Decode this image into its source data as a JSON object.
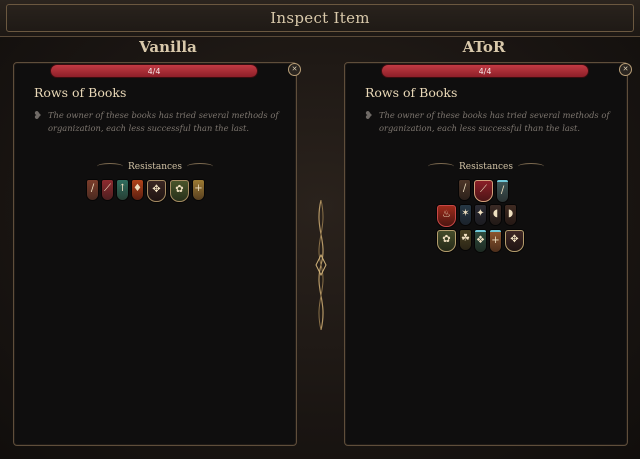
{
  "window": {
    "title": "Inspect Item"
  },
  "columns": [
    {
      "header": "Vanilla",
      "bar_text": "4/4",
      "item_name": "Rows of Books",
      "description": "The owner of these books has tried several methods of organization, each less successful than the last.",
      "resistances_title": "Resistances",
      "icons": [
        "bludgeoning-icon",
        "slashing-icon",
        "piercing-icon",
        "fire-icon",
        "necrotic-icon",
        "poison-icon",
        "radiant-icon"
      ]
    },
    {
      "header": "AToR",
      "bar_text": "4/4",
      "item_name": "Rows of Books",
      "description": "The owner of these books has tried several methods of organization, each less successful than the last.",
      "resistances_title": "Resistances",
      "icons_row1": [
        "bludgeoning-icon",
        "slashing-icon",
        "piercing-icon"
      ],
      "icons_row2": [
        "fire-icon",
        "cold-icon",
        "lightning-icon",
        "thunder-icon",
        "acid-icon"
      ],
      "icons_row3": [
        "poison-icon",
        "psychic-icon",
        "force-icon",
        "radiant-icon",
        "necrotic-icon"
      ]
    }
  ],
  "colors": {
    "bar": "#b02e37",
    "frame": "#5f4e3b",
    "panel": "#0f0e0e"
  }
}
